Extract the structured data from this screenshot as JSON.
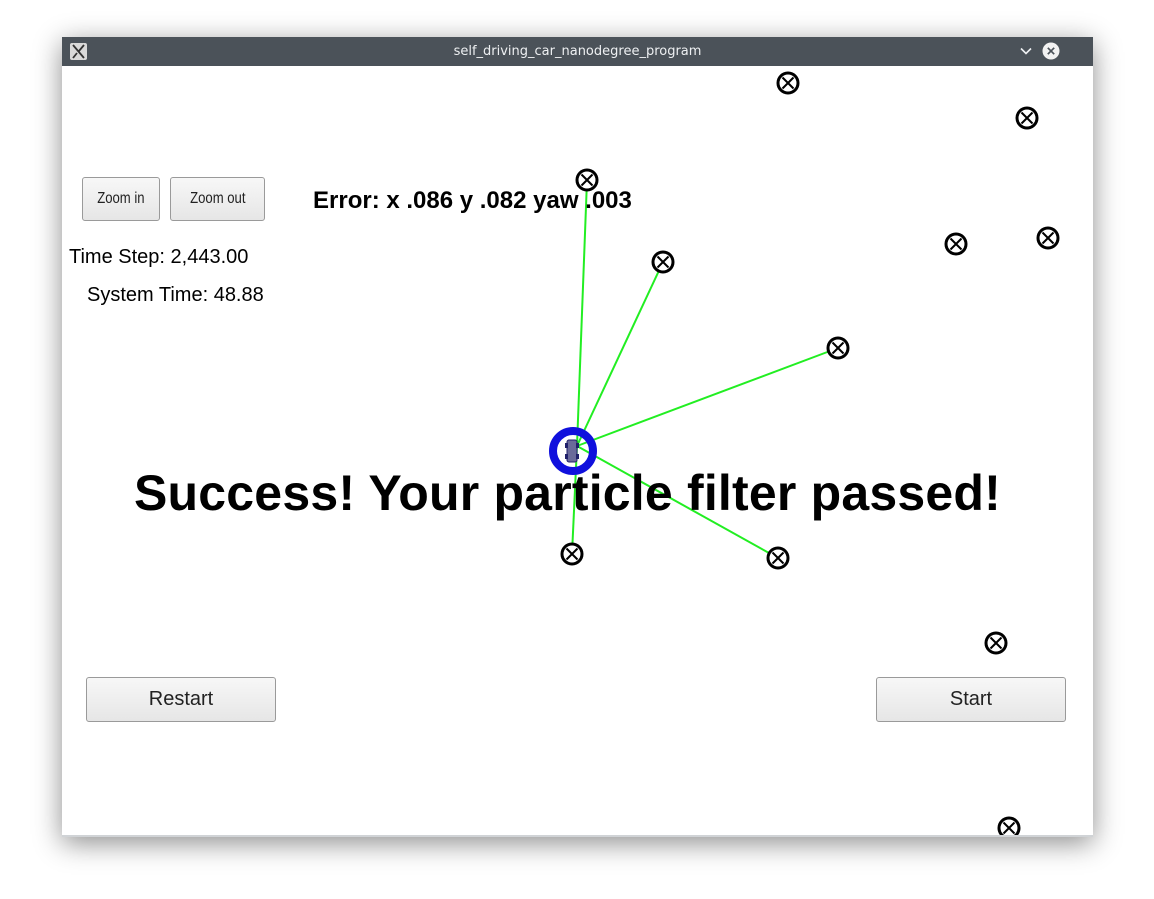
{
  "window": {
    "title": "self_driving_car_nanodegree_program",
    "app_icon": "x11-icon",
    "controls": [
      "minimize-chevron-icon",
      "close-icon"
    ]
  },
  "controls": {
    "zoom_in": "Zoom in",
    "zoom_out": "Zoom out",
    "restart": "Restart",
    "start": "Start"
  },
  "status": {
    "error": "Error: x .086 y .082 yaw .003",
    "time_step": "Time Step: 2,443.00",
    "system_time": "System Time: 48.88",
    "message": "Success! Your particle filter passed!"
  },
  "scene": {
    "landmark_icon": "landmark-marker-icon",
    "vehicle_icon": "vehicle-car-icon",
    "colors": {
      "observation_line": "#22ee22",
      "vehicle_ring": "#1010dd",
      "landmark": "#000000"
    }
  }
}
